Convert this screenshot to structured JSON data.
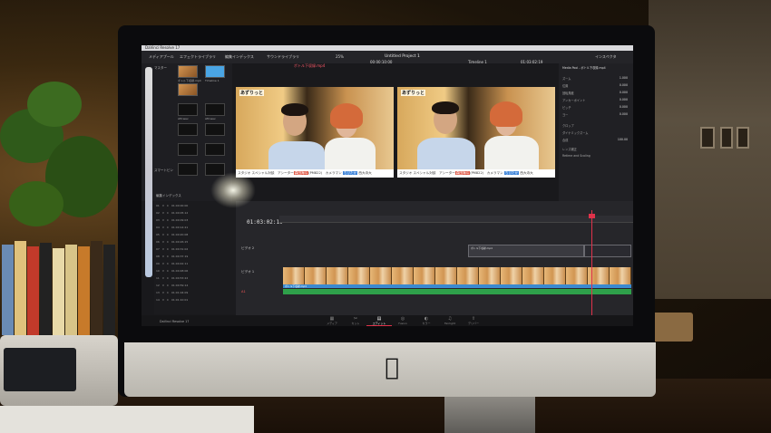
{
  "app": {
    "name": "DaVinci Resolve 17",
    "project_title": "Untitled Project 1",
    "timeline_name": "Timeline 1"
  },
  "toolbar": {
    "media_pool": "メディアプール",
    "effects": "エフェクトライブラリ",
    "edit_index": "編集インデックス",
    "sound_library": "サウンドライブラリ",
    "zoom": "25%",
    "source_timecode": "00:00:10:00",
    "record_timecode": "01:03:02:19",
    "viewer_clip_name": "ボトル下収録.mp4",
    "inspector_title": "インスペクタ"
  },
  "media_pool": {
    "section_label": "マスター",
    "smart_bins": "スマートビン",
    "edit_index": "編集インデックス",
    "thumbnails": [
      {
        "label": "ボトル下収録.mp4",
        "tone": "orange"
      },
      {
        "label": "Timeline 1",
        "tone": "blue"
      },
      {
        "label": "AM.wav",
        "tone": "dark"
      },
      {
        "label": "AM.wav",
        "tone": "dark"
      },
      {
        "label": "",
        "tone": "dark"
      },
      {
        "label": "",
        "tone": "dark"
      },
      {
        "label": "",
        "tone": "dark"
      },
      {
        "label": "",
        "tone": "dark"
      }
    ]
  },
  "viewer": {
    "left": {
      "caption_top": "あずりっと",
      "caption_bar_pre": "スタジオ スペシャル対談　アシーター",
      "caption_bar_red": "森田海斗",
      "caption_bar_mid": "(PM822)　カメラマン ",
      "caption_bar_blue": "ちびたか",
      "caption_bar_post": " 西大寺大"
    },
    "right": {
      "caption_top": "あずりっと",
      "caption_bar_pre": "スタジオ スペシャル対談　アシーター",
      "caption_bar_red": "森田海斗",
      "caption_bar_mid": "(PM822)　カメラマン ",
      "caption_bar_blue": "ちびたか",
      "caption_bar_post": " 西大寺大"
    }
  },
  "timeline": {
    "current_timecode": "01:03:02:19",
    "tracks": [
      {
        "id": "V2",
        "label": "ビデオ 2"
      },
      {
        "id": "V1",
        "label": "ビデオ 1"
      },
      {
        "id": "A1",
        "label": "A1"
      }
    ],
    "video_clip": "ボトル下収録.mp4",
    "title_clip": "ボトル下収録.mp4"
  },
  "inspector": {
    "clip_title": "Media Pool - ボトル下収録.mp4",
    "rows": [
      {
        "label": "ズーム",
        "value": "1.000"
      },
      {
        "label": "位置",
        "value": "0.000"
      },
      {
        "label": "回転角度",
        "value": "0.000"
      },
      {
        "label": "アンカーポイント",
        "value": "0.000"
      },
      {
        "label": "ピッチ",
        "value": "0.000"
      },
      {
        "label": "ヨー",
        "value": "0.000"
      },
      {
        "label": "クロップ",
        "value": ""
      },
      {
        "label": "ダイナミックズーム",
        "value": ""
      },
      {
        "label": "合成",
        "value": "100.00"
      },
      {
        "label": "レンズ補正",
        "value": ""
      },
      {
        "label": "Retime and Scaling",
        "value": ""
      }
    ]
  },
  "pages": [
    {
      "label": "メディア",
      "icon": "▦"
    },
    {
      "label": "カット",
      "icon": "✂"
    },
    {
      "label": "エディット",
      "icon": "▤",
      "active": true
    },
    {
      "label": "Fusion",
      "icon": "◎"
    },
    {
      "label": "カラー",
      "icon": "◐"
    },
    {
      "label": "Fairlight",
      "icon": "♫"
    },
    {
      "label": "デリバー",
      "icon": "⇪"
    }
  ],
  "colors": {
    "accent_red": "#e0324a",
    "clip_blue": "#3b82d8",
    "audio_green": "#2ea04a"
  }
}
